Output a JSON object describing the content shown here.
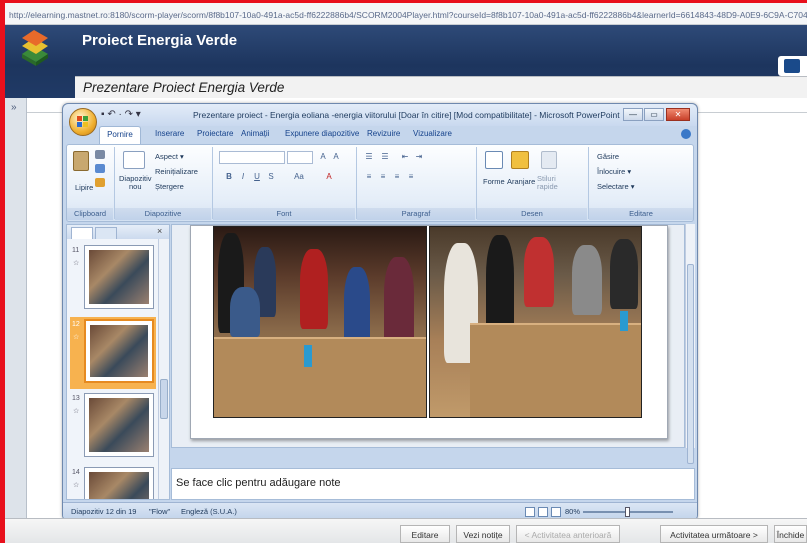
{
  "browser": {
    "url": "http://elearning.mastnet.ro:8180/scorm-player/scorm/8f8b107-10a0-491a-ac5d-ff6222886b4/SCORM2004Player.html?courseId=8f8b107-10a0-491a-ac5d-ff6222886b4&learnerId=6614843-48D9-A0E9-6C9A-C7042EBE93CF&plannedCourseId"
  },
  "course": {
    "title": "Proiect Energia Verde",
    "subtitle": "Prezentare Proiect Energia Verde"
  },
  "left_strip": {
    "toggle": "»"
  },
  "ppt": {
    "window_title": "Prezentare proiect - Energia eoliana -energia viitorului [Doar în citire] [Mod compatibilitate] - Microsoft PowerPoint",
    "qat": "▪ ↶ · ↷ ▾",
    "win_buttons": {
      "minimize": "—",
      "maximize": "▭",
      "close": "✕"
    },
    "tabs": [
      "Pornire",
      "Inserare",
      "Proiectare",
      "Animații",
      "Expunere diapozitive",
      "Revizuire",
      "Vizualizare"
    ],
    "ribbon": {
      "clipboard": {
        "label": "Clipboard",
        "paste": "Lipire"
      },
      "slides": {
        "label": "Diapozitive",
        "new_slide": "Diapozitiv\nnou",
        "layout": "Aspect ▾",
        "reset": "Reinițializare",
        "delete": "Ștergere"
      },
      "font": {
        "label": "Font"
      },
      "paragraph": {
        "label": "Paragraf"
      },
      "drawing": {
        "label": "Desen",
        "shapes": "Forme",
        "arrange": "Aranjare",
        "quick_styles": "Stiluri\nrapide"
      },
      "editing": {
        "label": "Editare",
        "find": "Găsire",
        "replace": "Înlocuire ▾",
        "select": "Selectare ▾"
      }
    },
    "thumbnails": [
      {
        "num": "11",
        "star": "☆",
        "selected": false
      },
      {
        "num": "12",
        "star": "☆",
        "selected": true
      },
      {
        "num": "13",
        "star": "☆",
        "selected": false
      },
      {
        "num": "14",
        "star": "☆",
        "selected": false
      }
    ],
    "notes_placeholder": "Se face clic pentru adăugare note",
    "status": {
      "slide": "Diapozitiv 12 din 19",
      "theme": "\"Flow\"",
      "lang": "Engleză (S.U.A.)",
      "zoom": "80%"
    }
  },
  "bottom_buttons": {
    "edit": "Editare",
    "notes": "Vezi notițe",
    "prev": "< Activitatea anterioară",
    "next": "Activitatea următoare >",
    "close": "Închide"
  },
  "colors": {
    "header": "#1d355e",
    "accent_red": "#e8101c",
    "ribbon": "#dbe6f4"
  }
}
